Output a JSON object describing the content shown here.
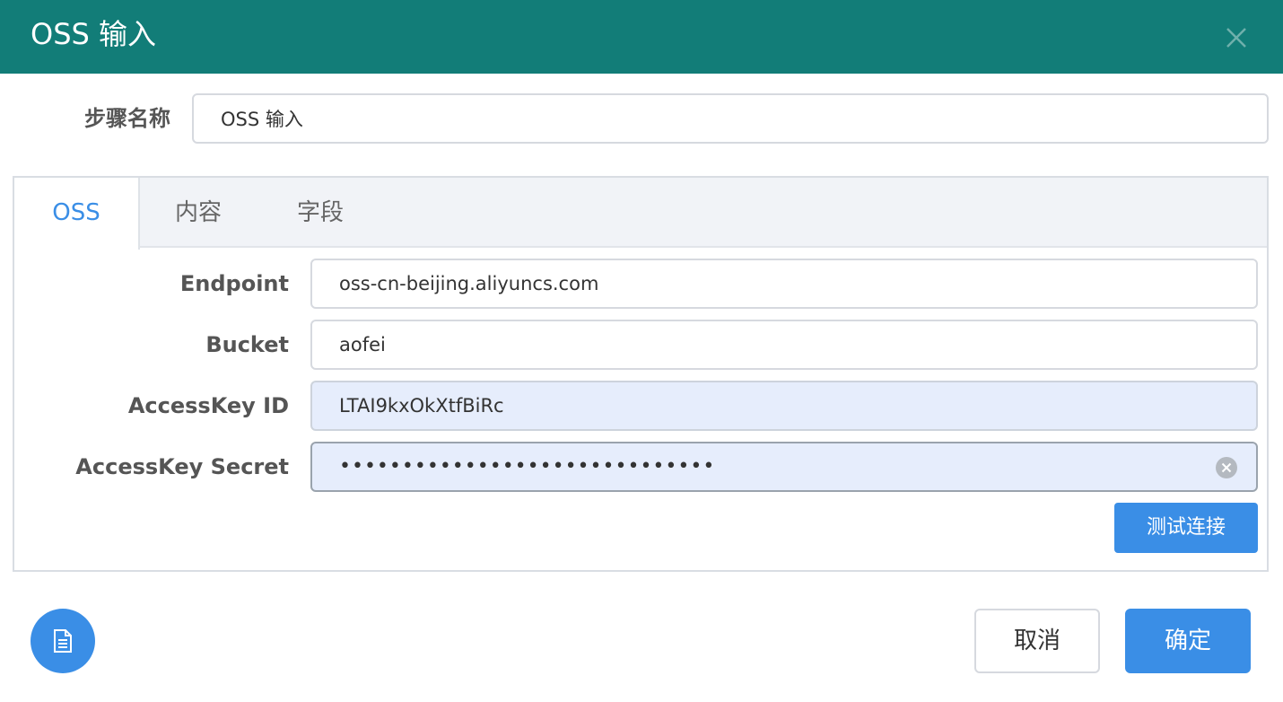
{
  "dialog": {
    "title": "OSS 输入"
  },
  "step": {
    "label": "步骤名称",
    "value": "OSS 输入"
  },
  "tabs": [
    {
      "label": "OSS",
      "active": true
    },
    {
      "label": "内容",
      "active": false
    },
    {
      "label": "字段",
      "active": false
    }
  ],
  "fields": {
    "endpoint": {
      "label": "Endpoint",
      "value": "oss-cn-beijing.aliyuncs.com"
    },
    "bucket": {
      "label": "Bucket",
      "value": "aofei"
    },
    "access_key_id": {
      "label": "AccessKey ID",
      "value": "LTAI9kxOkXtfBiRc"
    },
    "access_key_secret": {
      "label": "AccessKey Secret",
      "value": "••••••••••••••••••••••••••••••"
    }
  },
  "buttons": {
    "test_connection": "测试连接",
    "cancel": "取消",
    "confirm": "确定"
  },
  "icons": {
    "close": "close-icon",
    "clear": "clear-circle-icon",
    "document": "document-icon"
  },
  "colors": {
    "header_bg": "#127d78",
    "primary": "#3a8ee6",
    "autofill_bg": "#e6edfc"
  }
}
